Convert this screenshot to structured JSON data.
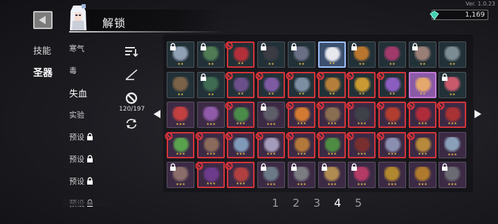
{
  "app": {
    "version": "Ver. 1.0.23"
  },
  "header": {
    "title": "解锁",
    "currency": "1,169",
    "currency_icon": "gem-icon"
  },
  "categories": [
    {
      "label": "技能",
      "active": false
    },
    {
      "label": "圣器",
      "active": true
    }
  ],
  "subcategories": [
    {
      "label": "寒气",
      "locked": false,
      "active": false
    },
    {
      "label": "毒",
      "locked": false,
      "active": false
    },
    {
      "label": "失血",
      "locked": false,
      "active": true
    },
    {
      "label": "实验",
      "locked": false,
      "active": false
    },
    {
      "label": "预设",
      "locked": true,
      "active": false
    },
    {
      "label": "预设",
      "locked": true,
      "active": false
    },
    {
      "label": "预设",
      "locked": true,
      "active": false
    },
    {
      "label": "预设",
      "locked": true,
      "active": false
    }
  ],
  "tools": {
    "sort_icon": "sort-icon",
    "filter_icon": "blade-filter-icon",
    "ban_icon": "ban-icon",
    "ban_count": "120/197",
    "refresh_icon": "refresh-icon"
  },
  "colors": {
    "ban_red": "#d8343b",
    "star_gold": "#e3b84a",
    "selected_border": "#9fc3ff",
    "rarity3_bg": "#3c2a45",
    "rarity2_bg": "#223137"
  },
  "grid": {
    "rows": [
      [
        {
          "stars": "★★",
          "status": "locked",
          "color": "#8fa0b4"
        },
        {
          "stars": "★★",
          "status": "locked",
          "color": "#4f7a54"
        },
        {
          "stars": "★★",
          "status": "banned",
          "color": "#b3303a"
        },
        {
          "stars": "★★",
          "status": "locked",
          "color": "#3b3b44"
        },
        {
          "stars": "★★",
          "status": "locked",
          "color": "#6a6f86"
        },
        {
          "stars": "★★",
          "status": "selected",
          "color": "#e7e7ee"
        },
        {
          "stars": "★★",
          "status": "locked",
          "color": "#b9762f"
        },
        {
          "stars": "★★",
          "status": "normal",
          "color": "#a03a6b"
        },
        {
          "stars": "★★",
          "status": "locked",
          "color": "#9a7f76"
        },
        {
          "stars": "★★",
          "status": "normal",
          "color": "#7b8c92"
        }
      ],
      [
        {
          "stars": "★★",
          "status": "normal",
          "color": "#7a6248"
        },
        {
          "stars": "★★",
          "status": "locked",
          "color": "#3f6b52"
        },
        {
          "stars": "★★",
          "status": "banned",
          "color": "#6b4f8a"
        },
        {
          "stars": "★★",
          "status": "banned",
          "color": "#7e5aa2"
        },
        {
          "stars": "★★",
          "status": "banned",
          "color": "#7c8ea2"
        },
        {
          "stars": "★★",
          "status": "banned",
          "color": "#b57f3b"
        },
        {
          "stars": "★★",
          "status": "banned",
          "color": "#c99a33"
        },
        {
          "stars": "★★",
          "status": "banned",
          "color": "#8b5dbf"
        },
        {
          "stars": "★★",
          "status": "selected-purple",
          "color": "#e4a86c"
        },
        {
          "stars": "★★",
          "status": "locked",
          "color": "#c85a6c"
        }
      ],
      [
        {
          "stars": "★★★",
          "status": "normal",
          "color": "#c24040"
        },
        {
          "stars": "★★★",
          "status": "normal",
          "color": "#8f5aa7"
        },
        {
          "stars": "★★★",
          "status": "banned",
          "color": "#4b8b49"
        },
        {
          "stars": "★★★",
          "status": "locked",
          "color": "#5e5e68"
        },
        {
          "stars": "★★★",
          "status": "banned",
          "color": "#d27a32"
        },
        {
          "stars": "★★★",
          "status": "banned",
          "color": "#8a6e52"
        },
        {
          "stars": "★★★",
          "status": "banned",
          "color": "#3e4248"
        },
        {
          "stars": "★★★",
          "status": "banned",
          "color": "#b13d2f"
        },
        {
          "stars": "★★★",
          "status": "banned",
          "color": "#b12c3a"
        },
        {
          "stars": "★★★",
          "status": "banned",
          "color": "#a83233"
        }
      ],
      [
        {
          "stars": "★★★",
          "status": "banned",
          "color": "#5aa14e"
        },
        {
          "stars": "★★★",
          "status": "banned",
          "color": "#8a6a5a"
        },
        {
          "stars": "★★★",
          "status": "banned",
          "color": "#7f9ab8"
        },
        {
          "stars": "★★★",
          "status": "banned",
          "color": "#a39bb9"
        },
        {
          "stars": "★★★",
          "status": "banned",
          "color": "#b3793a"
        },
        {
          "stars": "★★★",
          "status": "banned",
          "color": "#4f8c43"
        },
        {
          "stars": "★★★",
          "status": "banned",
          "color": "#7a2f2f"
        },
        {
          "stars": "★★★",
          "status": "banned",
          "color": "#8a8fb0"
        },
        {
          "stars": "★★★",
          "status": "banned",
          "color": "#b7893b"
        },
        {
          "stars": "★★★",
          "status": "normal",
          "color": "#8aa0b8"
        }
      ],
      [
        {
          "stars": "★★★",
          "status": "locked",
          "color": "#8b6d6b"
        },
        {
          "stars": "★★★",
          "status": "banned",
          "color": "#6d3b8c"
        },
        {
          "stars": "★★★",
          "status": "banned",
          "color": "#b04040"
        },
        {
          "stars": "★★★",
          "status": "locked",
          "color": "#6b7a86"
        },
        {
          "stars": "★★★",
          "status": "locked",
          "color": "#7b7b82"
        },
        {
          "stars": "★★★",
          "status": "locked",
          "color": "#b08b52"
        },
        {
          "stars": "★★★",
          "status": "locked",
          "color": "#b33b66"
        },
        {
          "stars": "★★★",
          "status": "normal",
          "color": "#b1872f"
        },
        {
          "stars": "★★★",
          "status": "normal",
          "color": "#b07a2e"
        },
        {
          "stars": "★★★",
          "status": "locked",
          "color": "#6b6b74"
        }
      ]
    ]
  },
  "pagination": {
    "pages": [
      {
        "label": "1",
        "active": false
      },
      {
        "label": "2",
        "active": false
      },
      {
        "label": "3",
        "active": false
      },
      {
        "label": "4",
        "active": true
      },
      {
        "label": "5",
        "active": false
      }
    ],
    "prev_icon": "arrow-left-icon",
    "next_icon": "arrow-right-icon"
  }
}
